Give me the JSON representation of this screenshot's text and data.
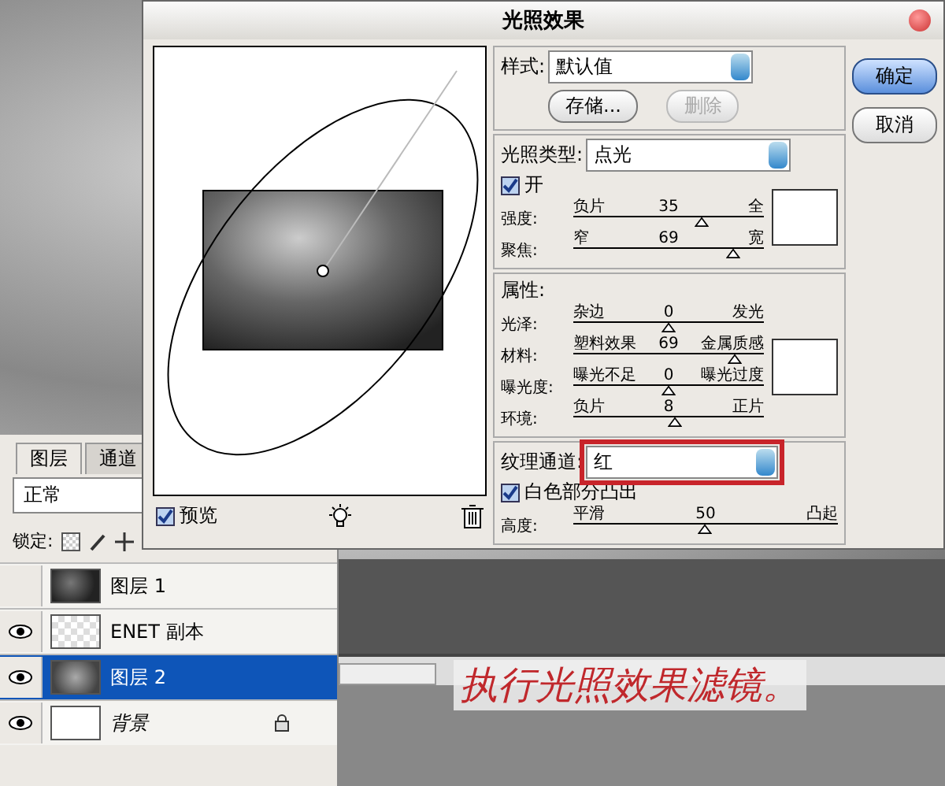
{
  "dialog": {
    "title": "光照效果",
    "preview": {
      "label": "预览",
      "checked": true
    },
    "style": {
      "label": "样式:",
      "value": "默认值"
    },
    "style_buttons": [
      {
        "label": "存储...",
        "disabled": false
      },
      {
        "label": "删除",
        "disabled": true
      }
    ],
    "actions": [
      {
        "label": "确定",
        "default": true
      },
      {
        "label": "取消",
        "default": false
      }
    ],
    "light_type": {
      "label": "光照类型:",
      "value": "点光"
    },
    "light_on": {
      "label": "开",
      "checked": true
    },
    "light_sliders": [
      {
        "label": "强度:",
        "min_label": "负片",
        "reading": "35",
        "max_label": "全",
        "level": 0.68
      },
      {
        "label": "聚焦:",
        "min_label": "窄",
        "reading": "69",
        "max_label": "宽",
        "level": 0.84
      }
    ],
    "properties": {
      "title": "属性:",
      "sliders": [
        {
          "label": "光泽:",
          "min_label": "杂边",
          "reading": "0",
          "max_label": "发光",
          "level": 0.5
        },
        {
          "label": "材料:",
          "min_label": "塑料效果",
          "reading": "69",
          "max_label": "金属质感",
          "level": 0.85
        },
        {
          "label": "曝光度:",
          "min_label": "曝光不足",
          "reading": "0",
          "max_label": "曝光过度",
          "level": 0.5
        },
        {
          "label": "环境:",
          "min_label": "负片",
          "reading": "8",
          "max_label": "正片",
          "level": 0.54
        }
      ]
    },
    "texture": {
      "label": "纹理通道:",
      "value": "红",
      "highlighted": true,
      "white_high": {
        "label": "白色部分凸出",
        "checked": true
      },
      "height": {
        "label": "高度:",
        "min_label": "平滑",
        "reading": "50",
        "max_label": "凸起",
        "level": 0.5
      }
    }
  },
  "layers_panel": {
    "tabs": [
      {
        "label": "图层",
        "selected": true
      },
      {
        "label": "通道",
        "selected": false
      }
    ],
    "blend_mode": "正常",
    "lock_label": "锁定:",
    "layers": [
      {
        "name": "图层 1",
        "kind": "dark-clouds",
        "visible": false,
        "selected": false,
        "locked": false,
        "italic": false
      },
      {
        "name": "ENET 副本",
        "kind": "text",
        "visible": true,
        "selected": false,
        "locked": false,
        "italic": false
      },
      {
        "name": "图层 2",
        "kind": "clouds",
        "visible": true,
        "selected": true,
        "locked": false,
        "italic": false
      },
      {
        "name": "背景",
        "kind": "blank",
        "visible": true,
        "selected": false,
        "locked": true,
        "italic": true
      }
    ]
  },
  "caption": "执行光照效果滤镜。"
}
